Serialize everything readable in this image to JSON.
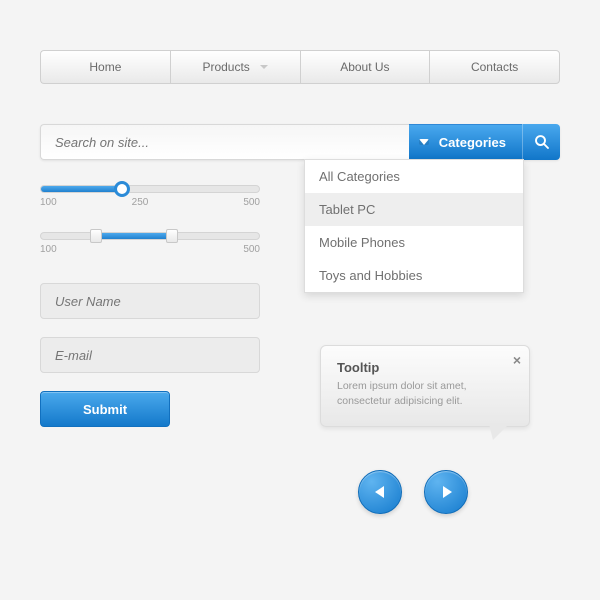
{
  "nav": {
    "items": [
      {
        "label": "Home",
        "dropdown": false
      },
      {
        "label": "Products",
        "dropdown": true
      },
      {
        "label": "About Us",
        "dropdown": false
      },
      {
        "label": "Contacts",
        "dropdown": false
      }
    ]
  },
  "search": {
    "placeholder": "Search on site...",
    "categories_label": "Categories",
    "dropdown": [
      {
        "label": "All Categories",
        "selected": false
      },
      {
        "label": "Tablet PC",
        "selected": true
      },
      {
        "label": "Mobile Phones",
        "selected": false
      },
      {
        "label": "Toys and Hobbies",
        "selected": false
      }
    ]
  },
  "slider1": {
    "min_label": "100",
    "mid_label": "250",
    "max_label": "500",
    "fill_pct": 37,
    "thumb_pct": 37
  },
  "slider2": {
    "min_label": "100",
    "max_label": "500",
    "fill_start_pct": 25,
    "fill_end_pct": 60,
    "thumb1_pct": 25,
    "thumb2_pct": 60
  },
  "form": {
    "username_placeholder": "User Name",
    "email_placeholder": "E-mail",
    "submit_label": "Submit"
  },
  "tooltip": {
    "title": "Tooltip",
    "body": "Lorem ipsum dolor sit amet, consectetur adipisicing elit."
  },
  "colors": {
    "accent": "#2586d6"
  }
}
